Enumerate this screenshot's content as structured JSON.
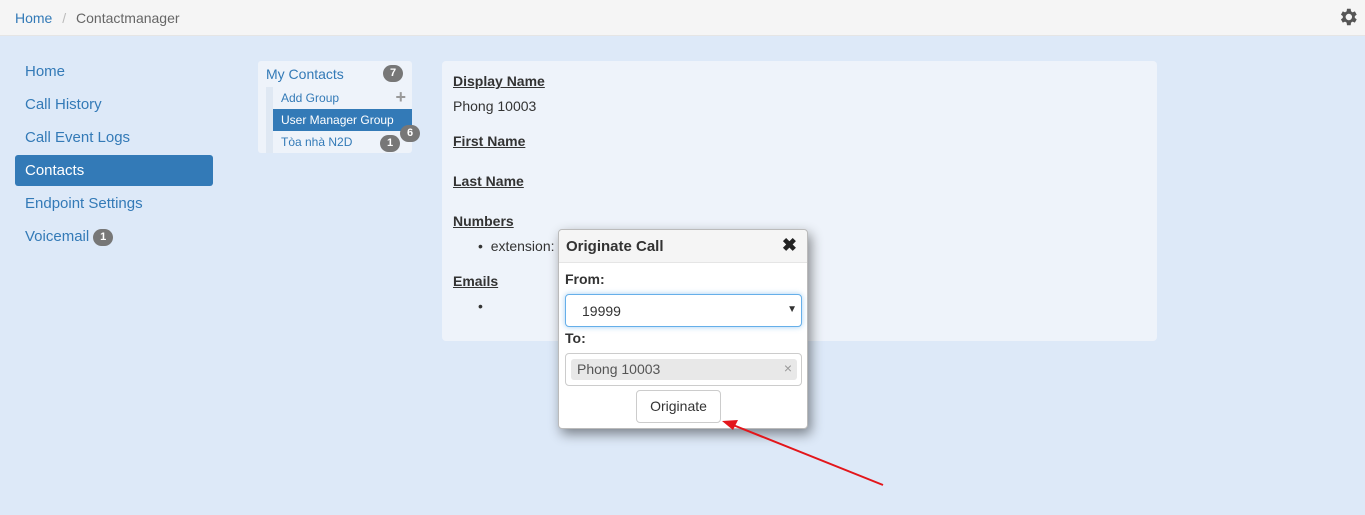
{
  "breadcrumb": {
    "home": "Home",
    "separator": "/",
    "current": "Contactmanager"
  },
  "settings_icon": "gear-icon",
  "nav": {
    "items": [
      {
        "label": "Home"
      },
      {
        "label": "Call History"
      },
      {
        "label": "Call Event Logs"
      },
      {
        "label": "Contacts",
        "active": true
      },
      {
        "label": "Endpoint Settings"
      },
      {
        "label": "Voicemail",
        "badge": "1"
      }
    ]
  },
  "tree": {
    "root": {
      "label": "My Contacts",
      "badge": "7"
    },
    "add_group": {
      "label": "Add Group",
      "icon": "plus-icon"
    },
    "groups": [
      {
        "label": "User Manager Group",
        "badge": "6",
        "selected": true
      },
      {
        "label": "Tòa nhà N2D",
        "badge": "1"
      }
    ]
  },
  "contact": {
    "display_name_label": "Display Name",
    "display_name": "Phong 10003",
    "first_name_label": "First Name",
    "last_name_label": "Last Name",
    "numbers_label": "Numbers",
    "numbers": [
      "extension:"
    ],
    "emails_label": "Emails",
    "emails": [
      ""
    ]
  },
  "modal": {
    "title": "Originate Call",
    "close": "✖",
    "from_label": "From:",
    "from_value": "19999",
    "to_label": "To:",
    "to_tag": "Phong 10003",
    "tag_remove": "×",
    "button": "Originate"
  },
  "colors": {
    "accent": "#337ab7",
    "background": "#dde9f8",
    "panel": "#eef3fa",
    "annotation_arrow": "#e3161b"
  }
}
